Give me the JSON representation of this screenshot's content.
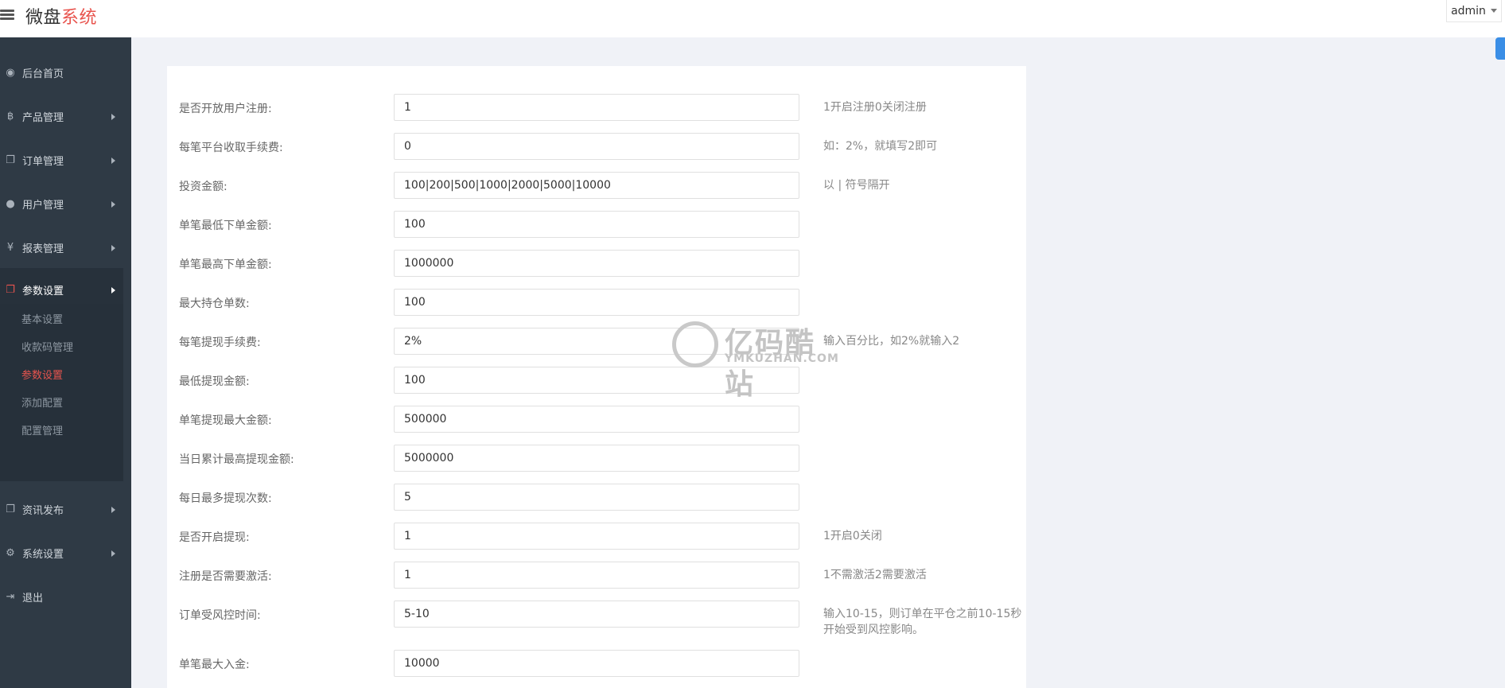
{
  "header": {
    "brand_main": "微盘",
    "brand_accent": "系统",
    "user": "admin"
  },
  "sidebar": {
    "items": [
      {
        "label": "后台首页",
        "icon": "dashboard-icon",
        "glyph": "◉"
      },
      {
        "label": "产品管理",
        "icon": "bitcoin-icon",
        "glyph": "฿"
      },
      {
        "label": "订单管理",
        "icon": "copy-icon",
        "glyph": "❐"
      },
      {
        "label": "用户管理",
        "icon": "user-icon",
        "glyph": "●"
      },
      {
        "label": "报表管理",
        "icon": "yen-icon",
        "glyph": "¥"
      },
      {
        "label": "参数设置",
        "icon": "copy-icon",
        "glyph": "❐"
      },
      {
        "label": "资讯发布",
        "icon": "copy-icon",
        "glyph": "❐"
      },
      {
        "label": "系统设置",
        "icon": "gears-icon",
        "glyph": "⚙"
      },
      {
        "label": "退出",
        "icon": "sign-out-icon",
        "glyph": "⇥"
      }
    ],
    "subitems": [
      "基本设置",
      "收款码管理",
      "参数设置",
      "添加配置",
      "配置管理"
    ]
  },
  "form": {
    "rows": [
      {
        "label": "是否开放用户注册:",
        "value": "1",
        "help": "1开启注册0关闭注册"
      },
      {
        "label": "每笔平台收取手续费:",
        "value": "0",
        "help": "如：2%，就填写2即可"
      },
      {
        "label": "投资金额:",
        "value": "100|200|500|1000|2000|5000|10000",
        "help": "以 | 符号隔开"
      },
      {
        "label": "单笔最低下单金额:",
        "value": "100",
        "help": ""
      },
      {
        "label": "单笔最高下单金额:",
        "value": "1000000",
        "help": ""
      },
      {
        "label": "最大持仓单数:",
        "value": "100",
        "help": ""
      },
      {
        "label": "每笔提现手续费:",
        "value": "2%",
        "help": "输入百分比，如2%就输入2"
      },
      {
        "label": "最低提现金额:",
        "value": "100",
        "help": ""
      },
      {
        "label": "单笔提现最大金额:",
        "value": "500000",
        "help": ""
      },
      {
        "label": "当日累计最高提现金额:",
        "value": "5000000",
        "help": ""
      },
      {
        "label": "每日最多提现次数:",
        "value": "5",
        "help": ""
      },
      {
        "label": "是否开启提现:",
        "value": "1",
        "help": "1开启0关闭"
      },
      {
        "label": "注册是否需要激活:",
        "value": "1",
        "help": "1不需激活2需要激活"
      },
      {
        "label": "订单受风控时间:",
        "value": "5-10",
        "help": "输入10-15，则订单在平仓之前10-15秒开始受到风控影响。"
      },
      {
        "label": "单笔最大入金:",
        "value": "10000",
        "help": ""
      }
    ]
  },
  "watermark": {
    "main": "亿码酷站",
    "sub": "YMKUZHAN.COM"
  }
}
